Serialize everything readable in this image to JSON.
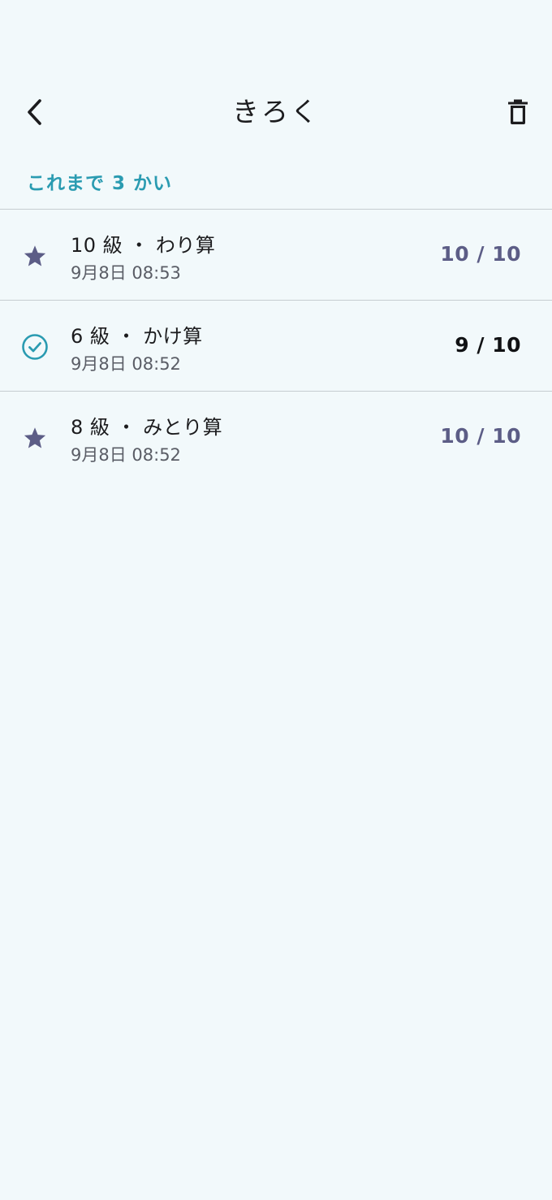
{
  "header": {
    "title": "きろく",
    "back_icon": "chevron-left-icon",
    "delete_icon": "trash-icon"
  },
  "summary": {
    "count_text": "これまで 3 かい"
  },
  "colors": {
    "accent": "#2a9bb1",
    "star": "#5c5d86",
    "background": "#f2f9fb"
  },
  "records": [
    {
      "title": "10 級 ・ わり算",
      "date": "9月8日 08:53",
      "score": "10 / 10",
      "icon": "star-icon"
    },
    {
      "title": "6 級 ・ かけ算",
      "date": "9月8日 08:52",
      "score": "9 / 10",
      "icon": "check-circle-icon"
    },
    {
      "title": "8 級 ・ みとり算",
      "date": "9月8日 08:52",
      "score": "10 / 10",
      "icon": "star-icon"
    }
  ]
}
